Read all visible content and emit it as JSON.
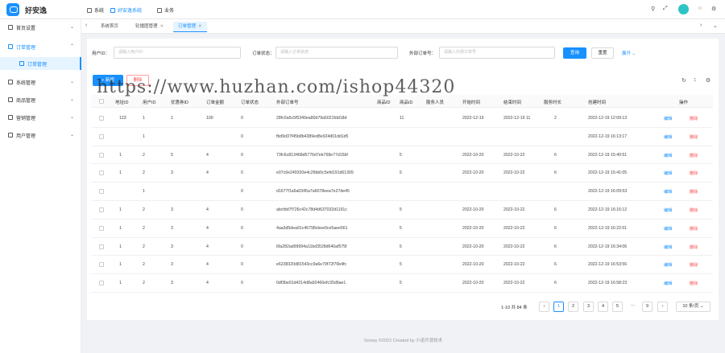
{
  "header": {
    "brand": "好安逸",
    "menus": [
      {
        "label": "系统",
        "icon": "grid-icon"
      },
      {
        "label": "好安逸系统",
        "icon": "grid-icon"
      },
      {
        "label": "业务",
        "icon": "grid-icon"
      }
    ],
    "tools": [
      "search-icon",
      "fullscreen-icon",
      "bell-icon",
      "globe-icon",
      "gear-icon"
    ]
  },
  "sidebar": {
    "items": [
      {
        "label": "首页设置"
      },
      {
        "label": "订单管理"
      },
      {
        "label": "订单管理"
      },
      {
        "label": "系统管理"
      },
      {
        "label": "商品管理"
      },
      {
        "label": "营销管理"
      },
      {
        "label": "用户管理"
      }
    ]
  },
  "tabs": [
    {
      "label": "系统首页"
    },
    {
      "label": "轮播图管理"
    },
    {
      "label": "订单管理"
    }
  ],
  "search": {
    "user_id_label": "用户ID：",
    "user_id_placeholder": "请输入用户ID",
    "status_label": "订单状态：",
    "status_placeholder": "请输入订单状态",
    "outno_label": "外部订单号：",
    "outno_placeholder": "请输入外部订单号",
    "query": "查询",
    "reset": "重置",
    "expand": "展开"
  },
  "toolbar": {
    "add": "+ 新增",
    "delete": "删除"
  },
  "table": {
    "columns": [
      "地址ID",
      "用户ID",
      "优惠券ID",
      "订单金额",
      "订单状态",
      "外部订单号",
      "商品ID",
      "商品ID",
      "服务人员",
      "开始时间",
      "结束时间",
      "服务时长",
      "创建时间",
      "操作"
    ],
    "edit_label": "编辑",
    "delete_label": "删除",
    "rows": [
      {
        "c1": "123",
        "c2": "1",
        "c3": "1",
        "c4": "100",
        "c5": "0",
        "c6": "28fc0a5c5f5349ea80d79a5021fdd18d",
        "c7": "11",
        "c10": "2022-12-19",
        "c11": "2022-12-19 11",
        "c12": "2",
        "c13": "2022-12-19 12:09:13"
      },
      {
        "c1": "",
        "c2": "1",
        "c3": "",
        "c4": "",
        "c5": "0",
        "c6": "fbd9d37f45b8b4389ed8e924d01dd1d5",
        "c7": "",
        "c10": "",
        "c11": "",
        "c12": "",
        "c13": "2022-12-19 16:13:17"
      },
      {
        "c1": "1",
        "c2": "2",
        "c3": "5",
        "c4": "4",
        "c5": "0",
        "c6": "73fc6c813468d5776d7eb768e77d15bf",
        "c7": "5",
        "c10": "2022-10-20",
        "c11": "2022-10-22",
        "c12": "6",
        "c13": "2022-12-19 15:40:51"
      },
      {
        "c1": "1",
        "c2": "2",
        "c3": "3",
        "c4": "4",
        "c5": "0",
        "c6": "e07c6e249330e4c26bb5c5efd191d61309",
        "c7": "5",
        "c10": "2022-10-20",
        "c11": "2022-10-22",
        "c12": "6",
        "c13": "2022-12-19 15:41:05"
      },
      {
        "c1": "",
        "c2": "1",
        "c3": "",
        "c4": "",
        "c5": "0",
        "c6": "d1677f1a5a0345a7a6078eea7e27de45",
        "c7": "",
        "c10": "",
        "c11": "",
        "c12": "",
        "c13": "2022-12-19 16:09:53"
      },
      {
        "c1": "1",
        "c2": "2",
        "c3": "3",
        "c4": "4",
        "c5": "0",
        "c6": "abcfdd7f726c42c78d4d637032d1191c",
        "c7": "5",
        "c10": "2022-10-20",
        "c11": "2022-10-22",
        "c12": "6",
        "c13": "2022-12-19 16:16:12"
      },
      {
        "c1": "1",
        "c2": "2",
        "c3": "3",
        "c4": "4",
        "c5": "0",
        "c6": "4aa3d5dea91c46798cbee0ce5aee561",
        "c7": "5",
        "c10": "2022-10-20",
        "c11": "2022-10-22",
        "c12": "6",
        "c13": "2022-12-19 16:22:01"
      },
      {
        "c1": "1",
        "c2": "2",
        "c3": "3",
        "c4": "4",
        "c5": "0",
        "c6": "6fa282ad99994a11bd3528d640af575f",
        "c7": "5",
        "c10": "2022-10-20",
        "c11": "2022-10-22",
        "c12": "6",
        "c13": "2022-12-19 16:34:06"
      },
      {
        "c1": "1",
        "c2": "2",
        "c3": "3",
        "c4": "4",
        "c5": "0",
        "c6": "e6238320d81543cc9a6e79f72f76b4fc",
        "c7": "5",
        "c10": "2022-10-20",
        "c11": "2022-10-22",
        "c12": "6",
        "c13": "2022-12-19 16:53:56"
      },
      {
        "c1": "1",
        "c2": "2",
        "c3": "3",
        "c4": "4",
        "c5": "0",
        "c6": "0df3be91d4214d8a92466efc35d9ae1",
        "c7": "5",
        "c10": "2022-10-20",
        "c11": "2022-10-22",
        "c12": "6",
        "c13": "2022-12-19 16:58:23"
      }
    ]
  },
  "pagination": {
    "total": "1-10 共 84 条",
    "pages": [
      "1",
      "2",
      "3",
      "4",
      "5",
      "···",
      "9"
    ],
    "page_size": "10 条/页",
    "current": 1
  },
  "footer": "Snowy ©2022 Created by 小诺开源技术",
  "watermark": "https://www.huzhan.com/ishop44320"
}
